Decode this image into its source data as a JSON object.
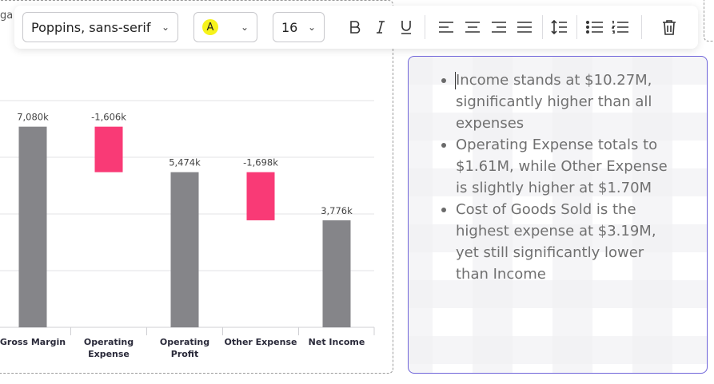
{
  "cut_text": "ga",
  "toolbar": {
    "font_family": "Poppins, sans-serif",
    "text_color_label": "A",
    "font_size": "16"
  },
  "chart_data": {
    "type": "bar",
    "subtype": "waterfall",
    "categories": [
      "Gross Margin",
      "Operating Expense",
      "Operating Profit",
      "Other Expense",
      "Net Income"
    ],
    "category_lines": [
      [
        "Gross Margin"
      ],
      [
        "Operating",
        "Expense"
      ],
      [
        "Operating",
        "Profit"
      ],
      [
        "Other Expense"
      ],
      [
        "Net Income"
      ]
    ],
    "values": [
      7080,
      -1606,
      5474,
      -1698,
      3776
    ],
    "labels": [
      "7,080k",
      "-1,606k",
      "5,474k",
      "-1,698k",
      "3,776k"
    ],
    "ylim": [
      0,
      10000
    ],
    "grid": true,
    "colors": {
      "total": "#858589",
      "negative": "#f93a76"
    }
  },
  "text_panel": {
    "bullets": [
      "Income stands at $10.27M, significantly higher than all expenses",
      "Operating Expense totals to $1.61M, while Other Expense is slightly higher at $1.70M",
      "Cost of Goods Sold is the highest expense at $3.19M, yet still significantly lower than Income"
    ]
  }
}
